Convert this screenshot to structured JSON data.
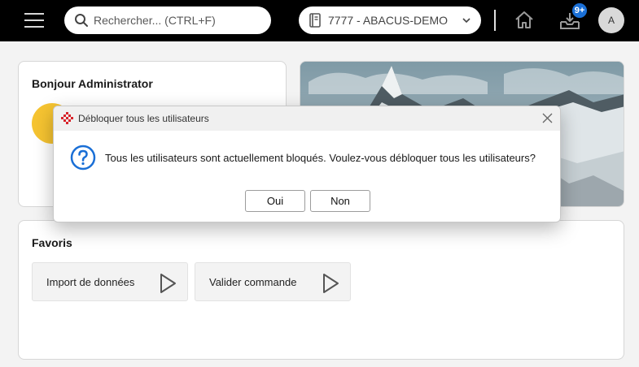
{
  "topbar": {
    "search": {
      "placeholder": "Rechercher... (CTRL+F)"
    },
    "mandant": {
      "label": "7777 - ABACUS-DEMO"
    },
    "notifications": {
      "badge": "9+"
    },
    "avatar": {
      "initial": "A"
    }
  },
  "greeting": {
    "title": "Bonjour Administrator"
  },
  "favorites": {
    "title": "Favoris",
    "items": [
      {
        "label": "Import de données"
      },
      {
        "label": "Valider commande"
      }
    ]
  },
  "dialog": {
    "title": "Débloquer tous les utilisateurs",
    "message": "Tous les utilisateurs sont actuellement bloqués. Voulez-vous débloquer tous les utilisateurs?",
    "buttons": {
      "yes": "Oui",
      "no": "Non"
    }
  },
  "colors": {
    "topbar": "#000000",
    "accent": "#1a6fd6",
    "question_icon": "#1a6fd6",
    "logo": "#d8232a",
    "sun": "#f6c431"
  }
}
